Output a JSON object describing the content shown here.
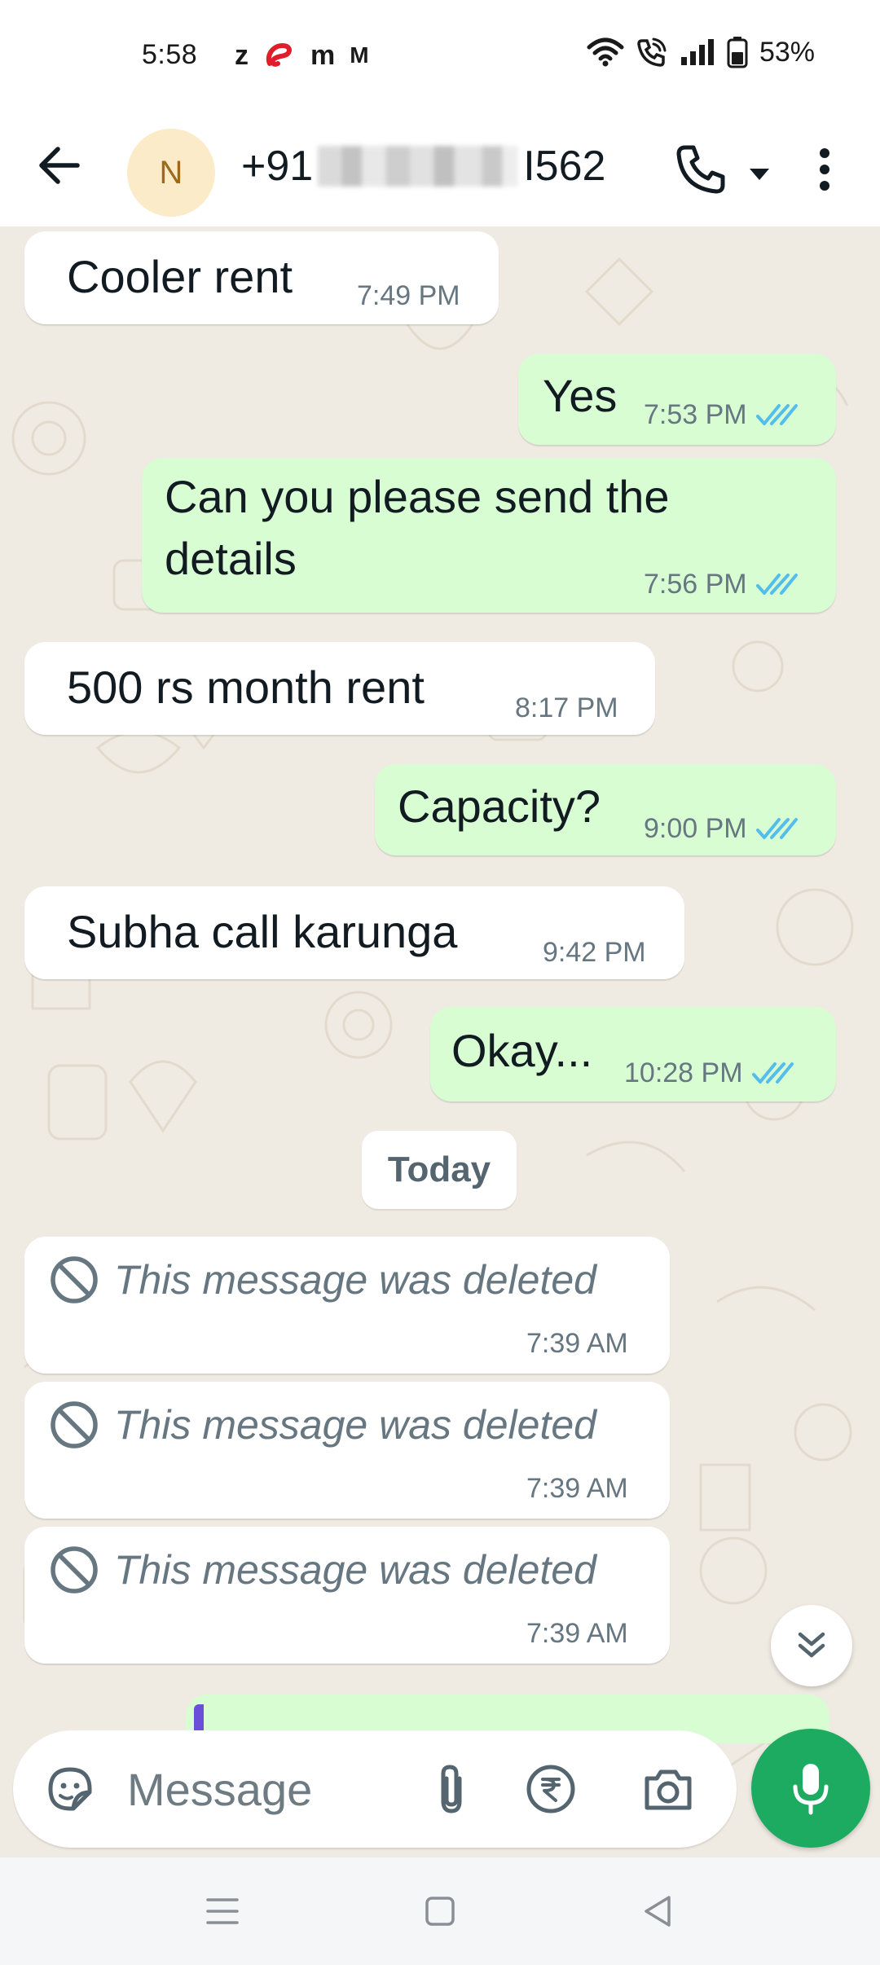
{
  "status_bar": {
    "time": "5:58",
    "apps": [
      "z",
      "m",
      "M"
    ],
    "battery": "53%"
  },
  "header": {
    "avatar_letter": "N",
    "contact_prefix": "+91",
    "contact_suffix": "I562"
  },
  "messages": [
    {
      "direction": "in",
      "text": "Cooler rent",
      "time": "7:49 PM"
    },
    {
      "direction": "out",
      "text": "Yes",
      "time": "7:53 PM",
      "status": "read"
    },
    {
      "direction": "out",
      "text_lines": [
        "Can you please send the",
        "details"
      ],
      "time": "7:56 PM",
      "status": "read"
    },
    {
      "direction": "in",
      "text": "500 rs month rent",
      "time": "8:17 PM"
    },
    {
      "direction": "out",
      "text": "Capacity?",
      "time": "9:00 PM",
      "status": "read"
    },
    {
      "direction": "in",
      "text": "Subha call karunga",
      "time": "9:42 PM"
    },
    {
      "direction": "out",
      "text": "Okay...",
      "time": "10:28 PM",
      "status": "read"
    }
  ],
  "date_divider": "Today",
  "deleted_messages": [
    {
      "text": "This message was deleted",
      "time": "7:39 AM"
    },
    {
      "text": "This message was deleted",
      "time": "7:39 AM"
    },
    {
      "text": "This message was deleted",
      "time": "7:39 AM"
    }
  ],
  "composer": {
    "placeholder": "Message"
  },
  "colors": {
    "accent_green": "#1daa61",
    "outgoing_bubble": "#d9fdd3",
    "read_tick": "#53bdeb",
    "chat_background": "#efeae2"
  },
  "icons": {
    "back": "arrow-left-icon",
    "call": "phone-icon",
    "more": "more-vertical-icon",
    "sticker": "sticker-icon",
    "attach": "paperclip-icon",
    "payment": "rupee-icon",
    "camera": "camera-icon",
    "mic": "mic-icon",
    "scroll": "chevron-double-down-icon",
    "deleted": "blocked-icon"
  }
}
